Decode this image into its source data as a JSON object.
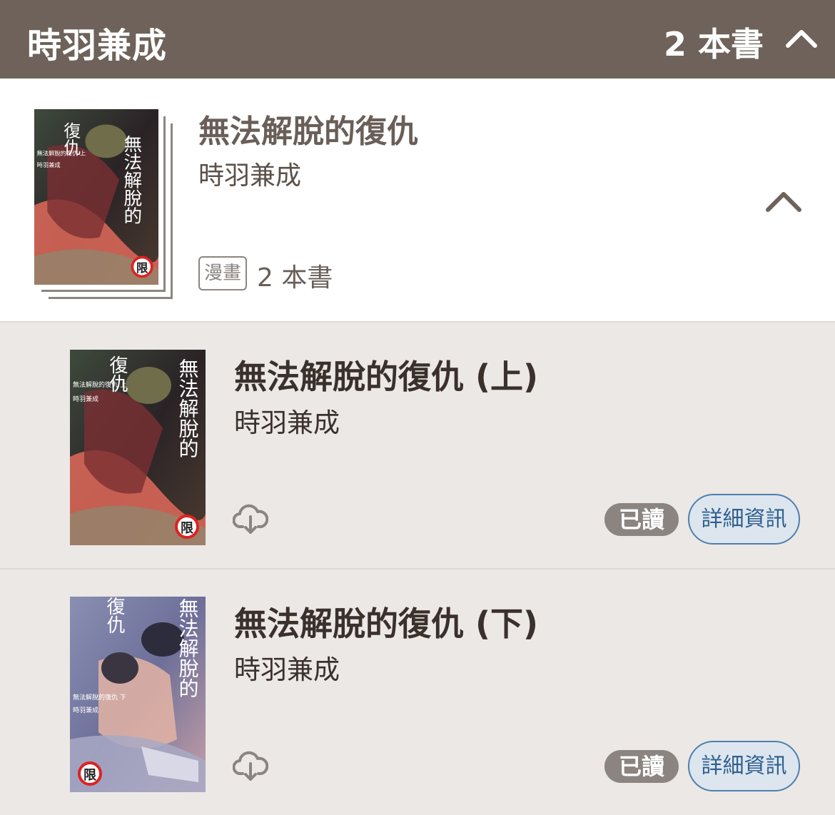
{
  "header": {
    "title": "時羽兼成",
    "count": "2 本書",
    "chevron": "chevron-up-icon"
  },
  "series": {
    "title": "無法解脫的復仇",
    "author": "時羽兼成",
    "genre_tag": "漫畫",
    "count": "2 本書",
    "cover": {
      "vertical_title": "無法解脫的",
      "side_title": "復仇",
      "rating_badge": "限",
      "small_text": "無法解脫的復仇 上",
      "small_author": "時羽兼成"
    }
  },
  "books": [
    {
      "title": "無法解脫的復仇 (上)",
      "author": "時羽兼成",
      "status": "已讀",
      "detail_label": "詳細資訊",
      "cover": {
        "vertical_title": "無法解脫的",
        "side_title": "復仇",
        "rating_badge": "限",
        "small_text": "無法解脫的復仇 上",
        "small_author": "時羽兼成"
      }
    },
    {
      "title": "無法解脫的復仇 (下)",
      "author": "時羽兼成",
      "status": "已讀",
      "detail_label": "詳細資訊",
      "cover": {
        "vertical_title": "無法解脫的",
        "side_title": "復仇",
        "rating_badge": "限",
        "small_text": "無法解脫的復仇 下",
        "small_author": "時羽兼成"
      }
    }
  ],
  "colors": {
    "header_bg": "#6e625a",
    "list_bg": "#ebe8e6",
    "detail_blue": "#2f5f8f",
    "read_badge": "#8b8480"
  }
}
